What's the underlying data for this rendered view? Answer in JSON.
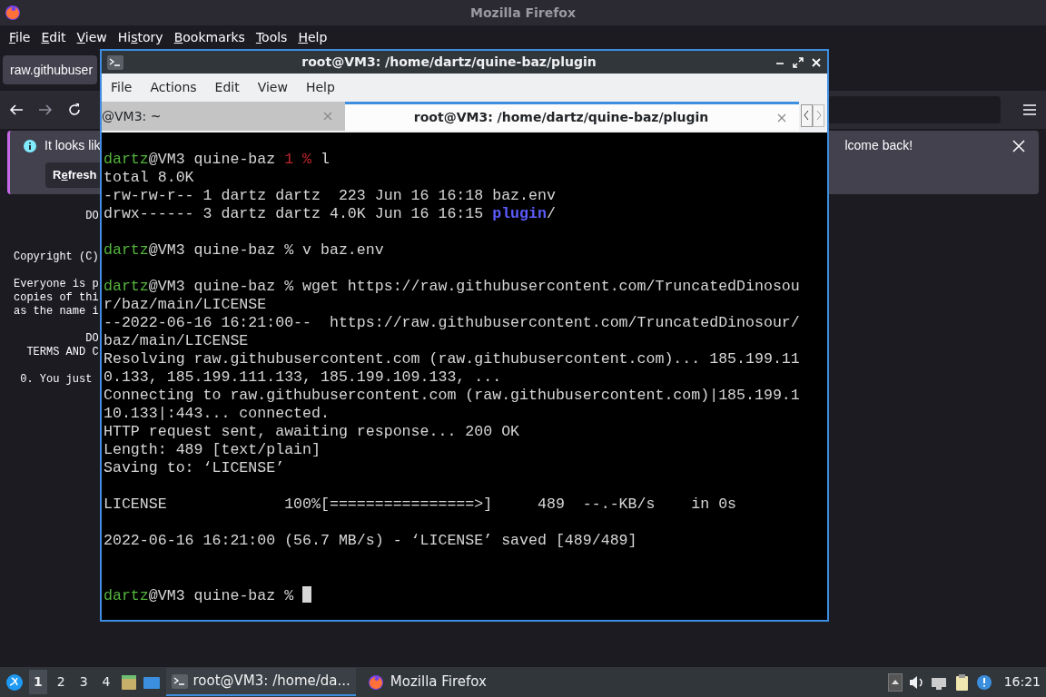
{
  "browser": {
    "title": "Mozilla Firefox",
    "menu": [
      {
        "key": "F",
        "after": "ile"
      },
      {
        "key": "E",
        "after": "dit"
      },
      {
        "key": "V",
        "after": "iew"
      },
      {
        "before": "Hi",
        "key": "s",
        "after": "tory"
      },
      {
        "key": "B",
        "after": "ookmarks"
      },
      {
        "key": "T",
        "after": "ools"
      },
      {
        "key": "H",
        "after": "elp"
      }
    ],
    "tab": {
      "label": "raw.githubuser"
    },
    "notification": {
      "text_start": "It looks lik",
      "text_end": "lcome back!",
      "button": {
        "before": "R",
        "key": "e",
        "after": "fresh"
      }
    },
    "page_lines": [
      {
        "kind": "text",
        "text": "           DO"
      },
      {
        "kind": "blank"
      },
      {
        "kind": "blank"
      },
      {
        "kind": "text",
        "text": "Copyright (C)"
      },
      {
        "kind": "blank"
      },
      {
        "kind": "text",
        "text": "Everyone is p"
      },
      {
        "kind": "text",
        "text": "copies of thi"
      },
      {
        "kind": "text",
        "text": "as the name i"
      },
      {
        "kind": "blank"
      },
      {
        "kind": "text",
        "text": "           DO"
      },
      {
        "kind": "text",
        "text": "  TERMS AND C"
      },
      {
        "kind": "blank"
      },
      {
        "kind": "text",
        "text": " 0. You just "
      }
    ]
  },
  "terminal": {
    "title": "root@VM3: /home/dartz/quine-baz/plugin",
    "menu": [
      "File",
      "Actions",
      "Edit",
      "View",
      "Help"
    ],
    "tabs": [
      {
        "label": "@VM3: ~",
        "selected": false
      },
      {
        "label": "root@VM3: /home/dartz/quine-baz/plugin",
        "selected": true
      }
    ],
    "lines": [
      {
        "kind": "blank"
      },
      {
        "kind": "text",
        "segments": [
          {
            "kind": "user",
            "text": "dartz"
          },
          {
            "kind": "plain",
            "text": "@VM3 quine-baz "
          },
          {
            "kind": "error",
            "text": "1 %"
          },
          {
            "kind": "plain",
            "text": " l"
          }
        ]
      },
      {
        "kind": "text",
        "segments": [
          {
            "kind": "plain",
            "text": "total 8.0K"
          }
        ]
      },
      {
        "kind": "text",
        "segments": [
          {
            "kind": "plain",
            "text": "-rw-rw-r-- 1 dartz dartz  223 Jun 16 16:18 baz.env"
          }
        ]
      },
      {
        "kind": "text",
        "segments": [
          {
            "kind": "plain",
            "text": "drwx------ 3 dartz dartz 4.0K Jun 16 16:15 "
          },
          {
            "kind": "dir",
            "text": "plugin"
          },
          {
            "kind": "plain",
            "text": "/"
          }
        ]
      },
      {
        "kind": "blank"
      },
      {
        "kind": "text",
        "segments": [
          {
            "kind": "user",
            "text": "dartz"
          },
          {
            "kind": "plain",
            "text": "@VM3 quine-baz % v baz.env"
          }
        ]
      },
      {
        "kind": "blank"
      },
      {
        "kind": "text",
        "segments": [
          {
            "kind": "user",
            "text": "dartz"
          },
          {
            "kind": "plain",
            "text": "@VM3 quine-baz % wget https://raw.githubusercontent.com/TruncatedDinosou"
          }
        ]
      },
      {
        "kind": "text",
        "segments": [
          {
            "kind": "plain",
            "text": "r/baz/main/LICENSE"
          }
        ]
      },
      {
        "kind": "text",
        "segments": [
          {
            "kind": "plain",
            "text": "--2022-06-16 16:21:00--  https://raw.githubusercontent.com/TruncatedDinosour/"
          }
        ]
      },
      {
        "kind": "text",
        "segments": [
          {
            "kind": "plain",
            "text": "baz/main/LICENSE"
          }
        ]
      },
      {
        "kind": "text",
        "segments": [
          {
            "kind": "plain",
            "text": "Resolving raw.githubusercontent.com (raw.githubusercontent.com)... 185.199.11"
          }
        ]
      },
      {
        "kind": "text",
        "segments": [
          {
            "kind": "plain",
            "text": "0.133, 185.199.111.133, 185.199.109.133, ..."
          }
        ]
      },
      {
        "kind": "text",
        "segments": [
          {
            "kind": "plain",
            "text": "Connecting to raw.githubusercontent.com (raw.githubusercontent.com)|185.199.1"
          }
        ]
      },
      {
        "kind": "text",
        "segments": [
          {
            "kind": "plain",
            "text": "10.133|:443... connected."
          }
        ]
      },
      {
        "kind": "text",
        "segments": [
          {
            "kind": "plain",
            "text": "HTTP request sent, awaiting response... 200 OK"
          }
        ]
      },
      {
        "kind": "text",
        "segments": [
          {
            "kind": "plain",
            "text": "Length: 489 [text/plain]"
          }
        ]
      },
      {
        "kind": "text",
        "segments": [
          {
            "kind": "plain",
            "text": "Saving to: ‘LICENSE’"
          }
        ]
      },
      {
        "kind": "blank"
      },
      {
        "kind": "text",
        "segments": [
          {
            "kind": "plain",
            "text": "LICENSE             100%[================>]     489  --.-KB/s    in 0s"
          }
        ]
      },
      {
        "kind": "blank"
      },
      {
        "kind": "text",
        "segments": [
          {
            "kind": "plain",
            "text": "2022-06-16 16:21:00 (56.7 MB/s) - ‘LICENSE’ saved [489/489]"
          }
        ]
      },
      {
        "kind": "blank"
      },
      {
        "kind": "blank"
      },
      {
        "kind": "text",
        "cursor": true,
        "segments": [
          {
            "kind": "user",
            "text": "dartz"
          },
          {
            "kind": "plain",
            "text": "@VM3 quine-baz % "
          }
        ]
      }
    ]
  },
  "taskbar": {
    "workspaces": [
      {
        "label": "1",
        "selected": true
      },
      {
        "label": "2",
        "selected": false
      },
      {
        "label": "3",
        "selected": false
      },
      {
        "label": "4",
        "selected": false
      }
    ],
    "tasks": [
      {
        "kind": "terminal",
        "label": "root@VM3: /home/da...",
        "selected": true
      },
      {
        "kind": "firefox",
        "label": "Mozilla Firefox",
        "selected": false
      }
    ],
    "clock": "16:21"
  }
}
